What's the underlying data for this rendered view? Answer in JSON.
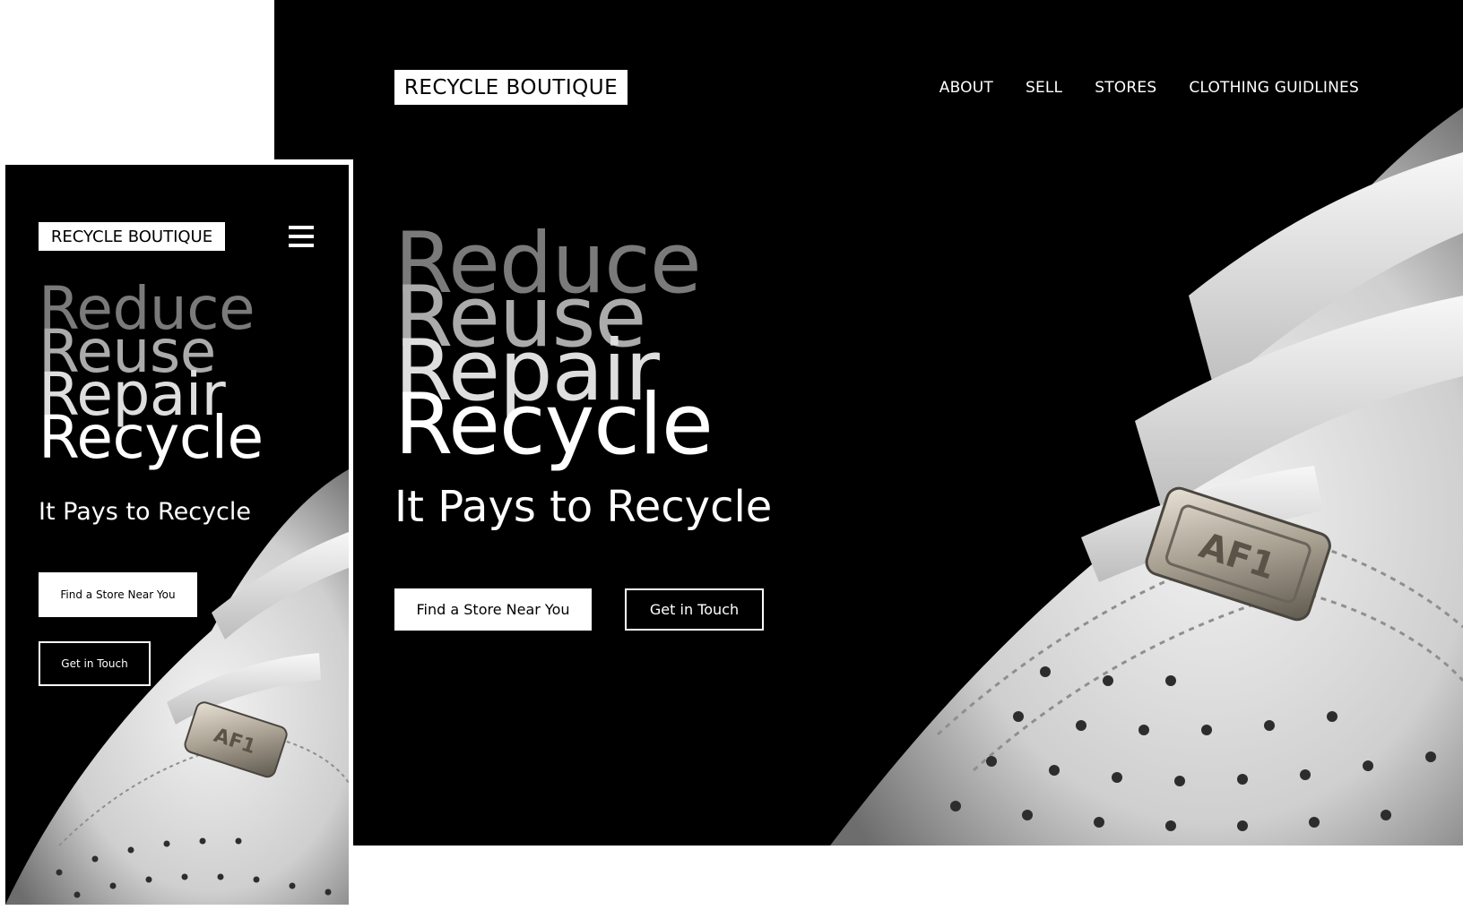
{
  "brand": "RECYCLE BOUTIQUE",
  "nav": [
    "ABOUT",
    "SELL",
    "STORES",
    "CLOTHING GUIDLINES"
  ],
  "headline": {
    "words": [
      "Reduce",
      "Reuse",
      "Repair",
      "Recycle"
    ],
    "colors": [
      "#7a7a7a",
      "#ababab",
      "#dedede",
      "#ffffff"
    ]
  },
  "tagline": "It Pays to Recycle",
  "buttons": {
    "primary": "Find a Store Near You",
    "secondary": "Get in Touch"
  },
  "icons": {
    "menu": "hamburger-menu-icon",
    "hero_image": "sneaker-photo"
  },
  "colors": {
    "background": "#000000",
    "foreground": "#ffffff"
  }
}
